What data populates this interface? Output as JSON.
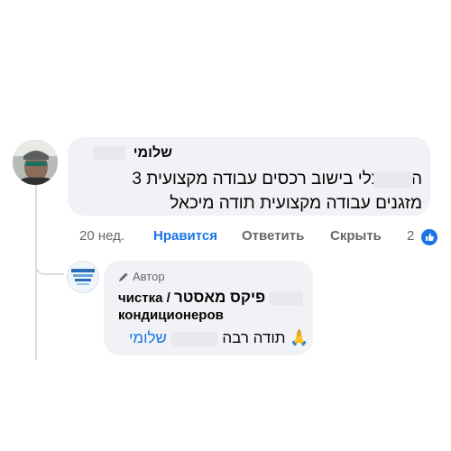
{
  "comment": {
    "author_name": "שלומי",
    "text_line1": "היה אצלי בישוב רכסים עבודה מקצועית 3",
    "text_line2": "מזגנים עבודה מקצועית תודה מיכאל",
    "time": "20 нед.",
    "like_label": "Нравится",
    "reply_label": "Ответить",
    "hide_label": "Скрыть",
    "reaction_count": "2",
    "reaction_icon": "thumbs-up-icon"
  },
  "reply": {
    "author_badge": "Автор",
    "author_badge_icon": "pen-icon",
    "author_name_part1": "чистка /",
    "author_name_hebrew": "פיקס מאסטר",
    "author_name_part2": "кондиционеров",
    "mention": "שלומי",
    "text": "תודה רבה",
    "emoji": "🙏"
  },
  "colors": {
    "bubble_bg": "#f0f2f5",
    "accent_blue": "#1b74e4",
    "muted": "#65676b",
    "thread_line": "#dcdee3"
  }
}
